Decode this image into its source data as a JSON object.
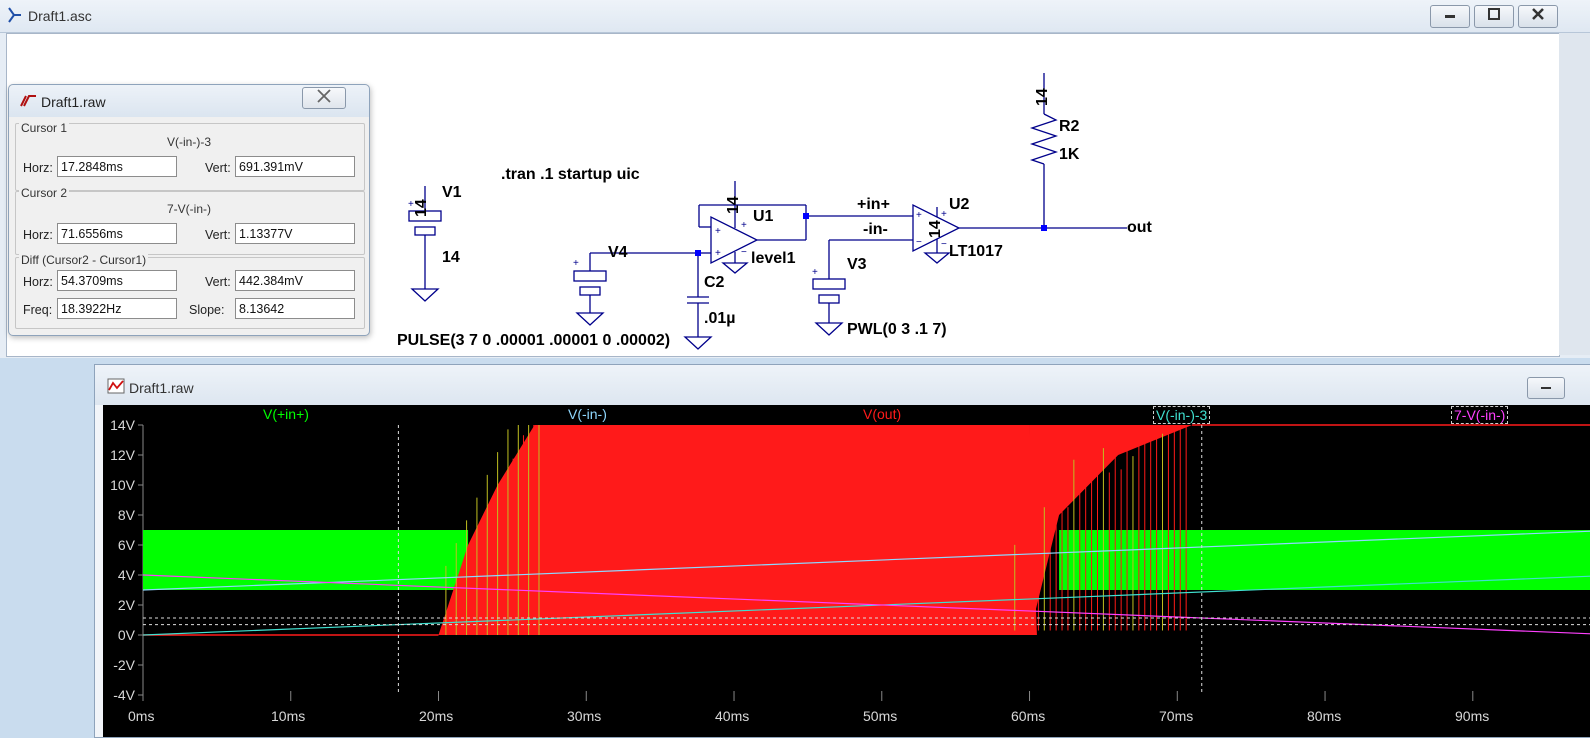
{
  "schematic_window": {
    "title": "Draft1.asc",
    "controls": [
      "▭",
      "⧉",
      "✕"
    ]
  },
  "cursor_dialog": {
    "title": "Draft1.raw",
    "cursor1": {
      "label": "Cursor 1",
      "trace": "V(-in-)-3",
      "horz_label": "Horz:",
      "horz": "17.2848ms",
      "vert_label": "Vert:",
      "vert": "691.391mV"
    },
    "cursor2": {
      "label": "Cursor 2",
      "trace": "7-V(-in-)",
      "horz_label": "Horz:",
      "horz": "71.6556ms",
      "vert_label": "Vert:",
      "vert": "1.13377V"
    },
    "diff": {
      "label": "Diff (Cursor2 - Cursor1)",
      "horz_label": "Horz:",
      "horz": "54.3709ms",
      "vert_label": "Vert:",
      "vert": "442.384mV",
      "freq_label": "Freq:",
      "freq": "18.3922Hz",
      "slope_label": "Slope:",
      "slope": "8.13642"
    }
  },
  "schematic": {
    "v1_value": "14",
    "v1_name": "V1",
    "v1_dc": "14",
    "tran_directive": ".tran .1 startup uic",
    "u1_supply": "14",
    "u1_name": "U1",
    "u1_model": "level1",
    "v4_name": "V4",
    "v4_value": "PULSE(3 7 0 .00001 .00001 0 .00002)",
    "c2_name": "C2",
    "c2_value": ".01µ",
    "net_in_plus": "+in+",
    "net_in_minus": "-in-",
    "u2_supply": "14",
    "u2_name": "U2",
    "u2_model": "LT1017",
    "v3_name": "V3",
    "v3_value": "PWL(0 3 .1 7)",
    "r2_supply": "14",
    "r2_name": "R2",
    "r2_value": "1K",
    "net_out": "out"
  },
  "waveform_window": {
    "title": "Draft1.raw",
    "traces": [
      {
        "name": "V(+in+)",
        "color": "#00ff00"
      },
      {
        "name": "V(-in-)",
        "color": "#8fd8ff"
      },
      {
        "name": "V(out)",
        "color": "#ff1a1a"
      },
      {
        "name": "V(-in-)-3",
        "color": "#40e0d0"
      },
      {
        "name": "7-V(-in-)",
        "color": "#ff40ff"
      }
    ],
    "y_ticks": [
      "14V",
      "12V",
      "10V",
      "8V",
      "6V",
      "4V",
      "2V",
      "0V",
      "-2V",
      "-4V"
    ],
    "x_ticks": [
      "0ms",
      "10ms",
      "20ms",
      "30ms",
      "40ms",
      "50ms",
      "60ms",
      "70ms",
      "80ms",
      "90ms"
    ]
  },
  "chart_data": {
    "type": "line",
    "xlabel": "",
    "ylabel": "",
    "xlim": [
      0,
      96
    ],
    "ylim": [
      -4,
      14
    ],
    "grid": false,
    "series": [
      {
        "name": "V(+in+)",
        "x": [
          0,
          96
        ],
        "y_low": [
          3,
          3
        ],
        "y_high": [
          7,
          7
        ]
      },
      {
        "name": "V(-in-)",
        "x": [
          0,
          100
        ],
        "y": [
          3,
          7
        ]
      },
      {
        "name": "V(out)",
        "x": [
          0,
          20,
          22,
          27,
          60,
          62,
          71
        ],
        "y": [
          0,
          0,
          6,
          14,
          14,
          6,
          14
        ]
      },
      {
        "name": "V(-in-)-3",
        "x": [
          0,
          100
        ],
        "y": [
          0,
          4
        ]
      },
      {
        "name": "7-V(-in-)",
        "x": [
          0,
          100
        ],
        "y": [
          4,
          0
        ]
      }
    ],
    "cursors": [
      {
        "trace": "V(-in-)-3",
        "x": 17.2848,
        "y": 0.691391
      },
      {
        "trace": "7-V(-in-)",
        "x": 71.6556,
        "y": 1.13377
      }
    ]
  }
}
